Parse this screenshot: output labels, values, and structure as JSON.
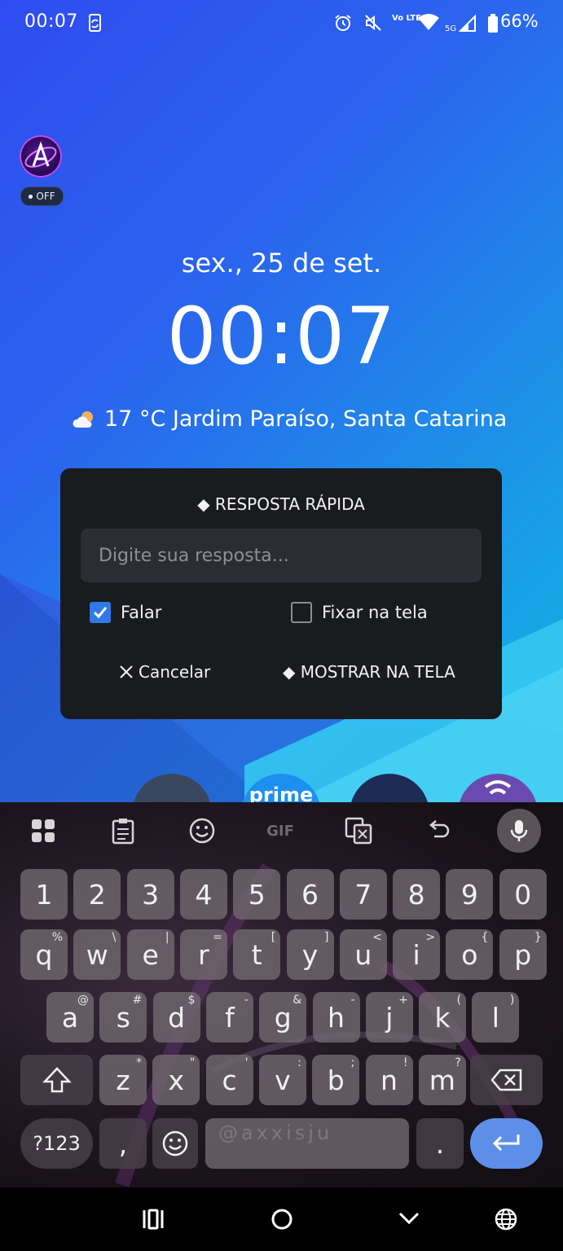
{
  "status_bar": {
    "time": "00:07",
    "battery_percent": "66%",
    "network_label": "5G",
    "volte_label": "Vo LTE",
    "icons": [
      "screen-rotate-icon",
      "alarm-icon",
      "mute-icon",
      "volte-icon",
      "wifi-icon",
      "signal-icon",
      "battery-icon"
    ]
  },
  "profile_badge": {
    "status": "OFF"
  },
  "lock_screen": {
    "date": "sex., 25 de set.",
    "clock": "00:07",
    "weather": "17 °C Jardim Paraíso, Santa Catarina"
  },
  "quick_reply": {
    "title": "◆ RESPOSTA RÁPIDA",
    "input_placeholder": "Digite sua resposta...",
    "input_value": "",
    "checkbox_speak": {
      "label": "Falar",
      "checked": true
    },
    "checkbox_pin": {
      "label": "Fixar na tela",
      "checked": false
    },
    "cancel_label": "Cancelar",
    "show_label": "◆ MOSTRAR NA TELA"
  },
  "dock": {
    "partial_label": "prime"
  },
  "keyboard": {
    "toolbar": [
      "apps-grid-icon",
      "clipboard-icon",
      "emoji-icon",
      "gif-icon",
      "translate-icon",
      "undo-icon",
      "mic-icon"
    ],
    "gif_label": "GIF",
    "number_row": [
      "1",
      "2",
      "3",
      "4",
      "5",
      "6",
      "7",
      "8",
      "9",
      "0"
    ],
    "row1": [
      {
        "k": "q",
        "h": "%"
      },
      {
        "k": "w",
        "h": "\\"
      },
      {
        "k": "e",
        "h": "|"
      },
      {
        "k": "r",
        "h": "="
      },
      {
        "k": "t",
        "h": "["
      },
      {
        "k": "y",
        "h": "]"
      },
      {
        "k": "u",
        "h": "<"
      },
      {
        "k": "i",
        "h": ">"
      },
      {
        "k": "o",
        "h": "{"
      },
      {
        "k": "p",
        "h": "}"
      }
    ],
    "row2": [
      {
        "k": "a",
        "h": "@"
      },
      {
        "k": "s",
        "h": "#"
      },
      {
        "k": "d",
        "h": "$"
      },
      {
        "k": "f",
        "h": "-"
      },
      {
        "k": "g",
        "h": "&"
      },
      {
        "k": "h",
        "h": "-"
      },
      {
        "k": "j",
        "h": "+"
      },
      {
        "k": "k",
        "h": "("
      },
      {
        "k": "l",
        "h": ")"
      }
    ],
    "row3": [
      {
        "k": "z",
        "h": "*"
      },
      {
        "k": "x",
        "h": "\""
      },
      {
        "k": "c",
        "h": "'"
      },
      {
        "k": "v",
        "h": ":"
      },
      {
        "k": "b",
        "h": ";"
      },
      {
        "k": "n",
        "h": "!"
      },
      {
        "k": "m",
        "h": "?"
      }
    ],
    "symbols_label": "?123",
    "comma": ",",
    "period": ".",
    "watermark": "@axxisju"
  },
  "nav_bar": {
    "icons": [
      "recents-icon",
      "home-icon",
      "back-icon",
      "language-icon"
    ]
  }
}
